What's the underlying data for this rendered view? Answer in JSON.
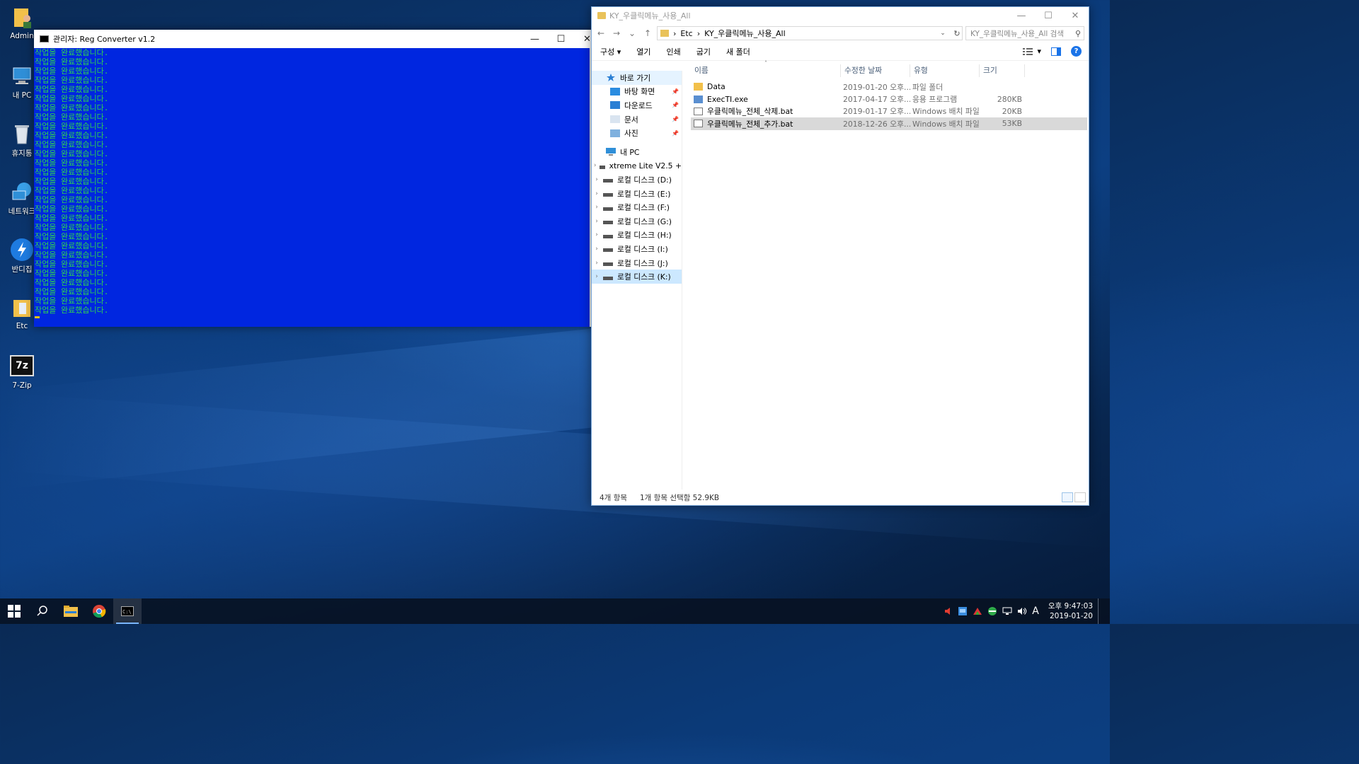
{
  "desktop": {
    "icons": [
      {
        "label": "Admin",
        "icon": "user-folder-icon"
      },
      {
        "label": "내 PC",
        "icon": "computer-icon"
      },
      {
        "label": "휴지통",
        "icon": "recycle-bin-icon"
      },
      {
        "label": "네트워크",
        "icon": "network-icon"
      },
      {
        "label": "반디집",
        "icon": "bandizip-icon"
      },
      {
        "label": "Etc",
        "icon": "folder-icon"
      },
      {
        "label": "7-Zip",
        "icon": "7zip-icon"
      }
    ],
    "sevenzip_logo": "7z"
  },
  "console": {
    "title": "관리자:  Reg Converter v1.2",
    "line_text": "작업을 완료했습니다.",
    "line_count": 29,
    "bg_color": "#0026e0",
    "text_color": "#2fd34f",
    "scroll_up": "˄",
    "scroll_down": "˅"
  },
  "explorer": {
    "title": "KY_우클릭메뉴_사용_All",
    "window_buttons": {
      "minimize": "—",
      "maximize": "☐",
      "close": "✕"
    },
    "nav": {
      "back": "←",
      "forward": "→",
      "recent": "⌄",
      "up": "↑"
    },
    "breadcrumb": [
      "Etc",
      "KY_우클릭메뉴_사용_All"
    ],
    "breadcrumb_sep": "›",
    "address_dropdown": "⌄",
    "refresh": "↻",
    "search_placeholder": "KY_우클릭메뉴_사용_All 검색",
    "toolbar": {
      "organize": "구성 ▾",
      "open": "열기",
      "print": "인쇄",
      "burn": "굽기",
      "new_folder": "새 폴더",
      "view_menu": "▾",
      "help": "?"
    },
    "navpane": {
      "quick_access": "바로 가기",
      "pinned": [
        {
          "label": "바탕 화면",
          "icon": "desktop-icon"
        },
        {
          "label": "다운로드",
          "icon": "download-icon"
        },
        {
          "label": "문서",
          "icon": "document-icon"
        },
        {
          "label": "사진",
          "icon": "pictures-icon"
        }
      ],
      "pin_glyph": "📌",
      "this_pc": "내 PC",
      "drives": [
        "xtreme Lite V2.5 +",
        "로컬 디스크 (D:)",
        "로컬 디스크 (E:)",
        "로컬 디스크 (F:)",
        "로컬 디스크 (G:)",
        "로컬 디스크 (H:)",
        "로컬 디스크 (I:)",
        "로컬 디스크 (J:)",
        "로컬 디스크 (K:)"
      ],
      "expand_glyph": "›"
    },
    "columns": {
      "name": "이름",
      "date": "수정한 날짜",
      "type": "유형",
      "size": "크기",
      "sort_arrow": "˄"
    },
    "files": [
      {
        "name": "Data",
        "date": "2019-01-20 오후...",
        "type": "파일 폴더",
        "size": "",
        "icon": "folder-icon"
      },
      {
        "name": "ExecTI.exe",
        "date": "2017-04-17 오후...",
        "type": "응용 프로그램",
        "size": "280KB",
        "icon": "exe-icon"
      },
      {
        "name": "우클릭메뉴_전체_삭제.bat",
        "date": "2019-01-17 오후...",
        "type": "Windows 배치 파일",
        "size": "20KB",
        "icon": "bat-icon"
      },
      {
        "name": "우클릭메뉴_전체_추가.bat",
        "date": "2018-12-26 오후...",
        "type": "Windows 배치 파일",
        "size": "53KB",
        "icon": "bat-icon"
      }
    ],
    "status": {
      "count": "4개 항목",
      "selection": "1개 항목 선택함 52.9KB"
    }
  },
  "taskbar": {
    "apps": [
      {
        "name": "start-icon"
      },
      {
        "name": "search-icon"
      },
      {
        "name": "file-explorer-icon"
      },
      {
        "name": "chrome-icon"
      },
      {
        "name": "console-icon"
      }
    ],
    "tray_icons": [
      "speaker-muted-icon",
      "app-tray-icon",
      "bandizip-tray-icon",
      "network-tray-icon",
      "volume-icon"
    ],
    "ime": "A",
    "time": "오후 9:47:03",
    "date": "2019-01-20",
    "colors": {
      "start": "#ffffff",
      "chrome_red": "#db4437",
      "chrome_green": "#0f9d58",
      "chrome_yellow": "#f4b400",
      "chrome_blue": "#4285f4"
    }
  }
}
